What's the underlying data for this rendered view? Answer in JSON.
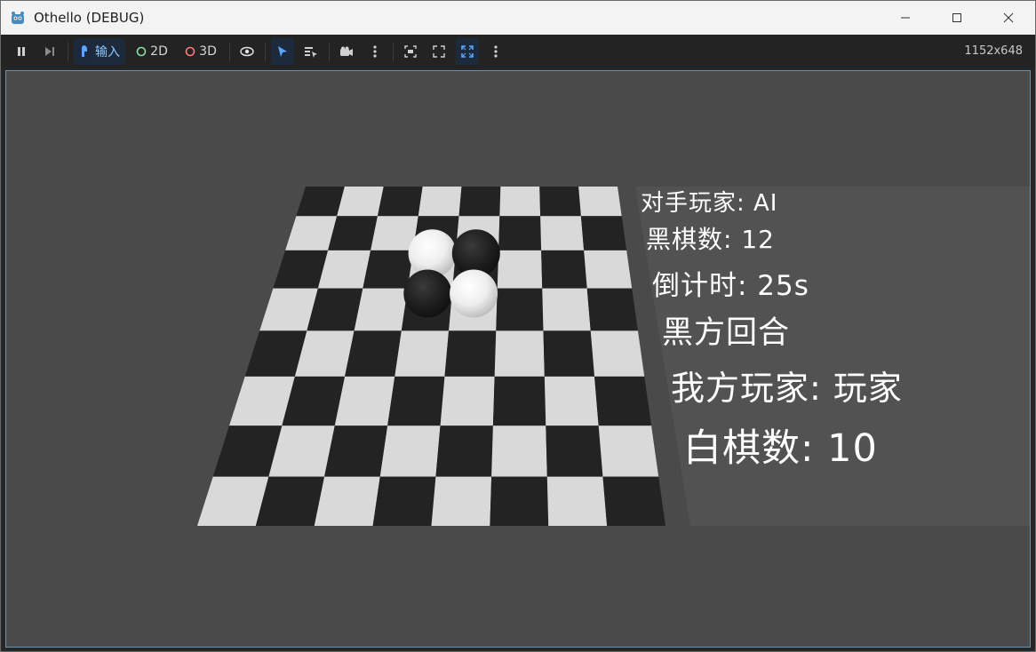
{
  "window": {
    "title": "Othello (DEBUG)",
    "app_icon": "godot-icon",
    "controls": [
      "minimize-icon",
      "maximize-icon",
      "close-icon"
    ]
  },
  "toolbar": {
    "input_label": "输入",
    "mode_2d_label": "2D",
    "mode_3d_label": "3D",
    "resolution": "1152x648",
    "icons": [
      "pause-icon",
      "step-icon",
      "input-icon",
      "eye-icon",
      "select-arrow-icon",
      "list-select-icon",
      "camera-icon",
      "more-icon",
      "camera-override-icon",
      "fullscreen-icon",
      "maximize-viewport-icon",
      "more-icon"
    ],
    "colors": {
      "accent": "#5aa7ff",
      "mode_2d": "#8de0a5",
      "mode_3d": "#ff7a7a"
    }
  },
  "hud": {
    "opponent": "对手玩家: AI",
    "black_count": "黑棋数: 12",
    "countdown": "倒计时: 25s",
    "turn": "黑方回合",
    "self_player": "我方玩家: 玩家",
    "white_count": "白棋数: 10"
  },
  "board": {
    "size": 8,
    "light_color": "#d9d9d9",
    "dark_color": "#232323",
    "pieces": [
      {
        "row": 2,
        "col": 3,
        "color": "white"
      },
      {
        "row": 2,
        "col": 4,
        "color": "black"
      },
      {
        "row": 3,
        "col": 3,
        "color": "black"
      },
      {
        "row": 3,
        "col": 4,
        "color": "white"
      }
    ]
  }
}
